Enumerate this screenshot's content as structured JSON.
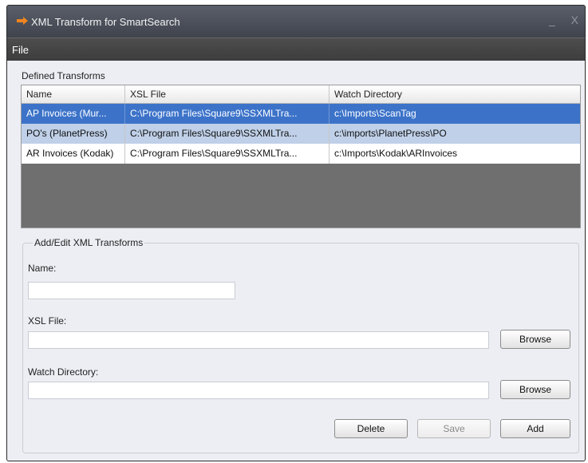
{
  "window": {
    "title": "XML Transform for SmartSearch",
    "minimize_glyph": "_",
    "close_glyph": "X"
  },
  "menu": {
    "file": "File"
  },
  "defined": {
    "label": "Defined Transforms",
    "columns": [
      "Name",
      "XSL File",
      "Watch Directory"
    ],
    "rows": [
      {
        "name": "AP Invoices (Mur...",
        "xsl": "C:\\Program Files\\Square9\\SSXMLTra...",
        "dir": "c:\\Imports\\ScanTag"
      },
      {
        "name": "PO's (PlanetPress)",
        "xsl": "C:\\Program Files\\Square9\\SSXMLTra...",
        "dir": "c:\\imports\\PlanetPress\\PO"
      },
      {
        "name": "AR Invoices (Kodak)",
        "xsl": "C:\\Program Files\\Square9\\SSXMLTra...",
        "dir": "c:\\Imports\\Kodak\\ARInvoices"
      }
    ]
  },
  "edit": {
    "legend": "Add/Edit XML Transforms",
    "name_label": "Name:",
    "name_value": "",
    "xsl_label": "XSL File:",
    "xsl_value": "",
    "watch_label": "Watch Directory:",
    "watch_value": "",
    "browse_label": "Browse",
    "delete_label": "Delete",
    "save_label": "Save",
    "add_label": "Add"
  },
  "colors": {
    "selected_row": "#3c73c9",
    "alt_row": "#bfd0e8",
    "grid_background": "#6f6f6f",
    "app_icon": "#f0851f"
  },
  "icons": {
    "app": "arrow-right-icon"
  }
}
